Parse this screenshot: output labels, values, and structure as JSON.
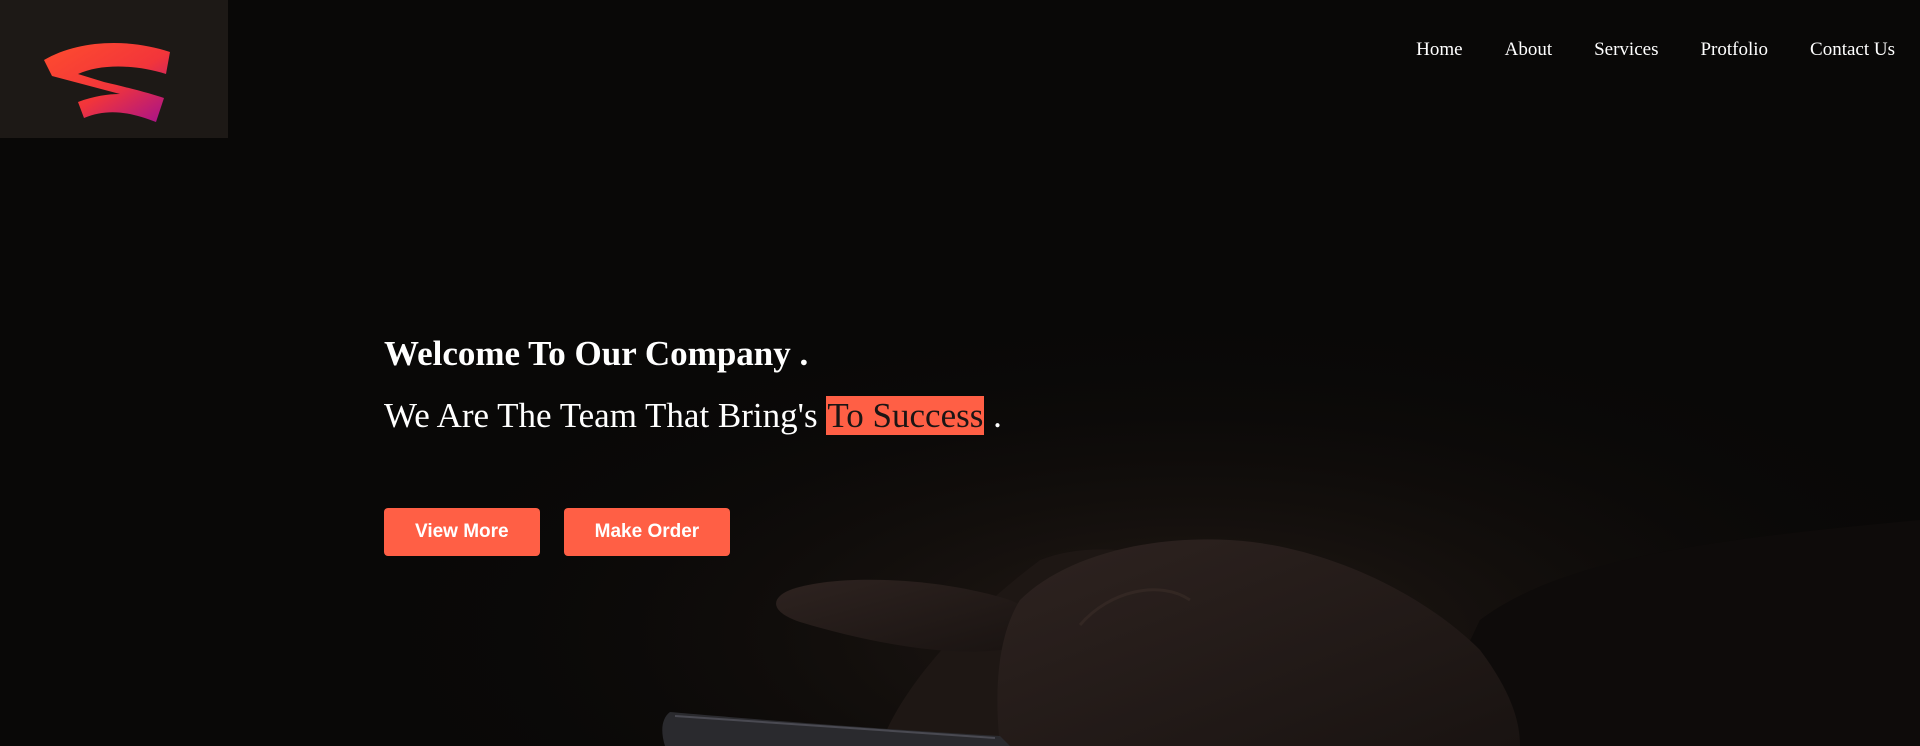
{
  "brand": {
    "logo_icon": "stadia-logo-icon",
    "colors": {
      "orange": "#ff4d2e",
      "magenta": "#b0108a"
    }
  },
  "nav": {
    "items": [
      {
        "label": "Home"
      },
      {
        "label": "About"
      },
      {
        "label": "Services"
      },
      {
        "label": "Protfolio"
      },
      {
        "label": "Contact Us"
      }
    ]
  },
  "hero": {
    "title": "Welcome To Our Company .",
    "subtitle_prefix": "We Are The Team That Bring's",
    "subtitle_highlight": "To Success",
    "subtitle_suffix": ".",
    "background_description_icon": "hand-holding-phone-image",
    "buttons": {
      "view_more": "View More",
      "make_order": "Make Order"
    }
  },
  "colors": {
    "accent": "#ff5f45",
    "background": "#090807",
    "text": "#ffffff"
  }
}
